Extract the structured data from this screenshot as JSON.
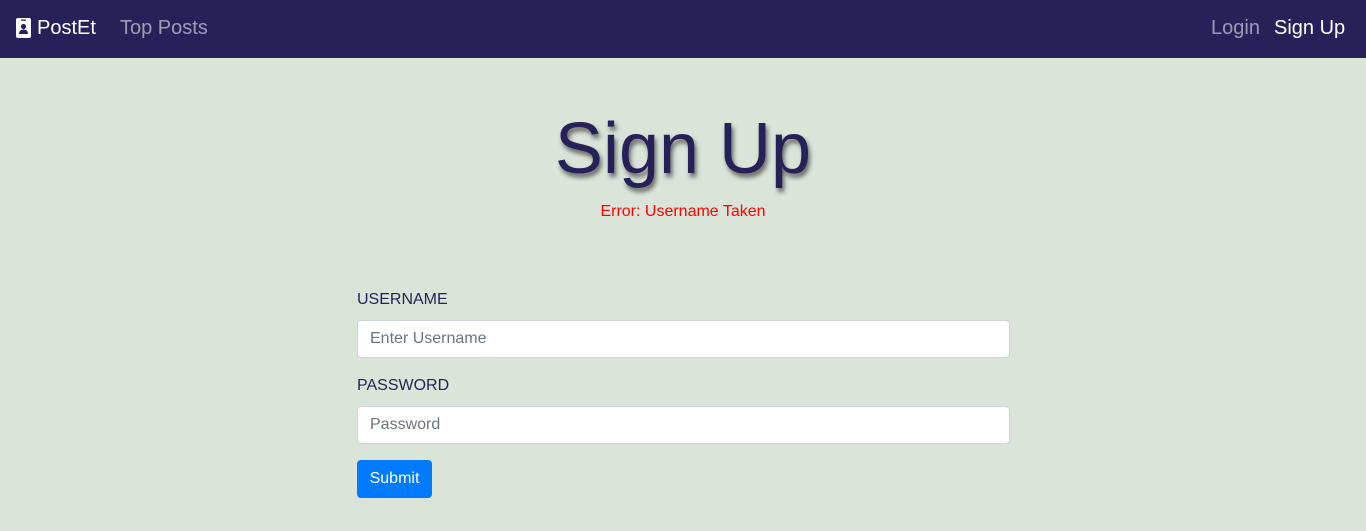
{
  "navbar": {
    "brand_icon": "person-badge-icon",
    "brand_label": "PostEt",
    "top_posts_label": "Top Posts",
    "login_label": "Login",
    "signup_label": "Sign Up",
    "background_color": "#262259"
  },
  "page": {
    "title": "Sign Up",
    "error": "Error: Username Taken",
    "background_color": "#dae4d9"
  },
  "form": {
    "username_label": "USERNAME",
    "username_placeholder": "Enter Username",
    "username_value": "",
    "password_label": "PASSWORD",
    "password_placeholder": "Password",
    "password_value": "",
    "submit_label": "Submit",
    "submit_color": "#007bff"
  }
}
